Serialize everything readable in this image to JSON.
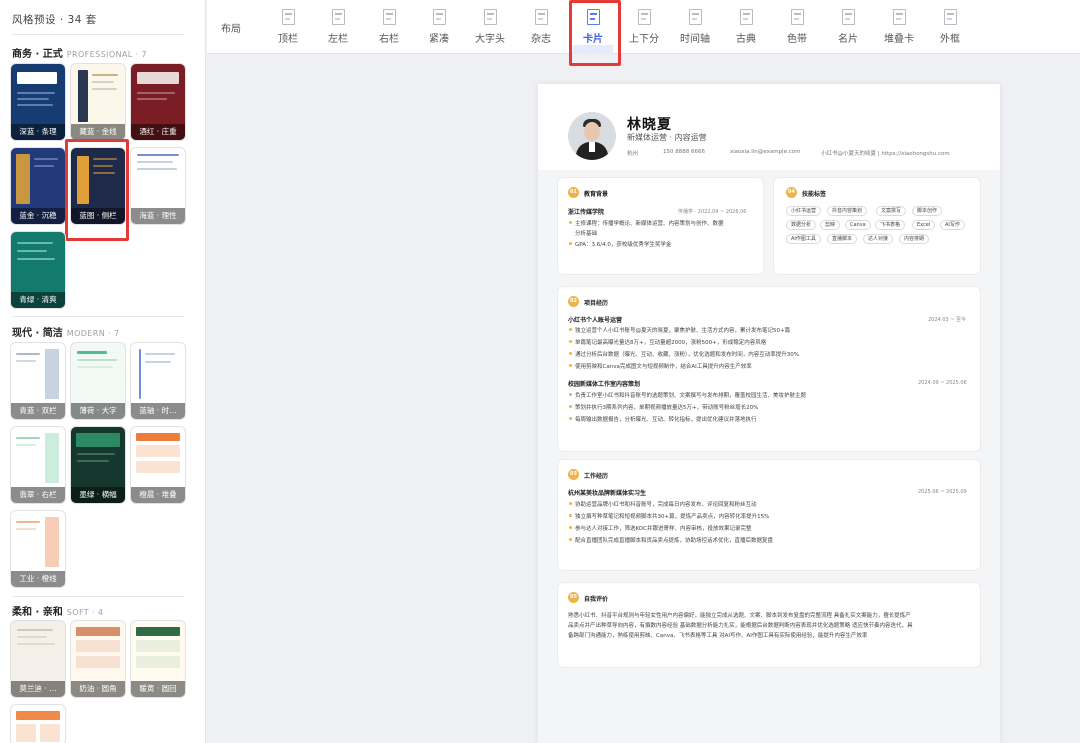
{
  "sidebar": {
    "title": "风格预设 · 34 套",
    "groups": [
      {
        "name": "商务 · 正式",
        "sub": "PROFESSIONAL · 7"
      },
      {
        "name": "现代 · 简洁",
        "sub": "MODERN · 7"
      },
      {
        "name": "柔和 · 亲和",
        "sub": "SOFT · 4"
      }
    ],
    "business": [
      "深蓝 · 条理",
      "藏蓝 · 金线",
      "酒红 · 庄重",
      "蓝金 · 沉稳",
      "蓝图 · 侧栏",
      "海蓝 · 理性",
      "青绿 · 清爽"
    ],
    "modern": [
      "青蓝 · 双栏",
      "薄荷 · 大字",
      "蓝轴 · 时…",
      "翡翠 · 右栏",
      "墨绿 · 横幅",
      "橙晨 · 堆叠",
      "工业 · 橙线"
    ],
    "soft": [
      "莫兰迪 · …",
      "奶油 · 圆角",
      "暖黄 · 圆回"
    ]
  },
  "toolbar": {
    "label": "布局",
    "items": [
      "顶栏",
      "左栏",
      "右栏",
      "紧凑",
      "大字头",
      "杂志",
      "卡片",
      "上下分",
      "时间轴",
      "古典",
      "色带",
      "名片",
      "堆叠卡",
      "外框"
    ],
    "active": "卡片"
  },
  "resume": {
    "name": "林晓夏",
    "role": "新媒体运营 · 内容运营",
    "contacts": [
      "杭州",
      "150 8888 6666",
      "xiaoxia.lin@example.com",
      "小红书@小夏天的晓夏 | https://xiaohongshu.com"
    ],
    "education": {
      "num": "01",
      "title": "教育背景",
      "school": "浙江传媒学院",
      "meta": "传播学 · 2022.09 ~ 2026.06",
      "lines": [
        "主修课程：传播学概论、新媒体运营、内容策划与创作、数据",
        "分析基础",
        "GPA：3.6/4.0，获校级优秀学生奖学金"
      ]
    },
    "skills": {
      "num": "04",
      "title": "技能标签",
      "tags": [
        "小红书运营",
        "抖音内容策划",
        "文案撰写",
        "脚本创作",
        "数据分析",
        "剪映",
        "Canva",
        "飞书表格",
        "Excel",
        "AI写作",
        "AI作图工具",
        "直播脚本",
        "达人对接",
        "内容排期"
      ]
    },
    "projects": {
      "num": "02",
      "title": "项目经历",
      "items": [
        {
          "name": "小红书个人账号运营",
          "date": "2024.03 ~ 至今",
          "lines": [
            "独立运营个人小红书账号@夏天的晓夏，聚焦护肤、生活方式内容，累计发布笔记50+篇",
            "单篇笔记最高曝光量达8万+，互动量超2000，涨粉500+，形成稳定内容风格",
            "通过分析后台数据（曝光、互动、收藏、涨粉），优化选题和发布时间，内容互动率提升30%",
            "使用剪映和Canva完成图文与短视频制作，结合AI工具提升内容生产效率"
          ]
        },
        {
          "name": "校园新媒体工作室内容策划",
          "date": "2024.09 ~ 2025.06",
          "lines": [
            "负责工作室小红书和抖音账号的选题策划、文案撰写与发布排期，覆盖校园生活、美妆护肤主题",
            "策划并执行3期系列内容，单期视频播放量达5万+，带动账号粉丝增长20%",
            "每周输出数据报告，分析曝光、互动、转化指标，提出优化建议并落地执行"
          ]
        }
      ]
    },
    "work": {
      "num": "03",
      "title": "工作经历",
      "name": "杭州某美妆品牌新媒体实习生",
      "date": "2025.06 ~ 2025.09",
      "lines": [
        "协助运营品牌小红书和抖音账号，完成每日内容发布、评论回复和粉丝互动",
        "独立撰写种草笔记和短视频脚本共30+篇，提炼产品卖点，内容转化率提升15%",
        "参与达人对接工作，筛选KOC并跟进寄样、内容审核，投放效果记录完整",
        "配合直播团队完成直播脚本和货品卖点提炼，协助场控话术优化，直播后数据复盘"
      ]
    },
    "summary": {
      "num": "05",
      "title": "自我评价",
      "lines": [
        "熟悉小红书、抖音平台规则与年轻女性用户内容偏好，能独立完成从选题、文案、脚本到发布复盘的完整流程 具备扎实文案能力，擅长提炼产",
        "品卖点并产出种草导向内容，有撰数内容经验 基础数据分析能力扎实，能根据后台数据判断内容表现并优化选题策略 适应快节奏内容迭代，具",
        "备跨部门沟通能力，熟练使用剪映、Canva、飞书表格等工具 对AI写作、AI作图工具有实际使用经验，能提升内容生产效率"
      ]
    }
  }
}
